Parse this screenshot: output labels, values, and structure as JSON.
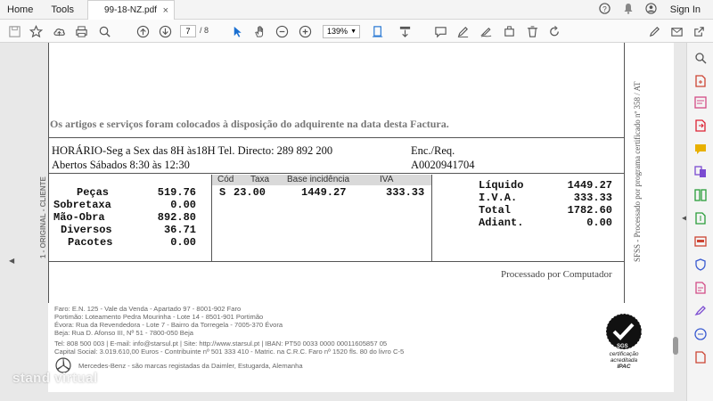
{
  "menu": {
    "home": "Home",
    "tools": "Tools",
    "tab_title": "99-18-NZ.pdf",
    "tab_close": "×",
    "sign_in": "Sign In"
  },
  "toolbar": {
    "page_current": "7",
    "page_total": "/ 8",
    "zoom": "139%"
  },
  "document": {
    "notice": "Os artigos e serviços foram colocados à disposição do adquirente na data desta Factura.",
    "schedule_line1": "HORÁRIO-Seg a Sex das 8H às18H Tel. Directo: 289 892 200",
    "schedule_line2": "Abertos Sábados 8:30 às 12:30",
    "enc_label": "Enc./Req.",
    "enc_value": "A0020941704",
    "side_left": "1 - ORIGINAL - CLIENTE",
    "side_right": "SFSS - Processado por programa certificado nº 358 / AT",
    "totals_left": [
      {
        "label": "Peças",
        "value": "519.76"
      },
      {
        "label": "Sobretaxa",
        "value": "0.00"
      },
      {
        "label": "Mão-Obra",
        "value": "892.80"
      },
      {
        "label": "Diversos",
        "value": "36.71"
      },
      {
        "label": "Pacotes",
        "value": "0.00"
      }
    ],
    "tax_headers": {
      "cod": "Cód",
      "taxa": "Taxa",
      "base": "Base incidência",
      "iva": "IVA"
    },
    "tax_row": {
      "cod": "S",
      "taxa": "23.00",
      "base": "1449.27",
      "iva": "333.33"
    },
    "totals_right": [
      {
        "label": "Líquido",
        "value": "1449.27"
      },
      {
        "label": "I.V.A.",
        "value": "333.33"
      },
      {
        "label": "Total",
        "value": "1782.60"
      },
      {
        "label": "Adiant.",
        "value": "0.00"
      }
    ],
    "processed": "Processado por Computador",
    "footer": [
      "Faro: E.N. 125 - Vale da Venda - Apartado 97 - 8001-902 Faro",
      "Portimão: Loteamento Pedra Mourinha - Lote 14 - 8501-901 Portimão",
      "Évora: Rua da Revendedora - Lote 7 - Bairro da Torregela - 7005-370 Évora",
      "Beja: Rua D. Afonso III, Nº 51 - 7800-050 Beja",
      "Tel: 808 500 003 | E-mail: info@starsul.pt | Site: http://www.starsul.pt | IBAN: PT50 0033 0000 00011605857 05",
      "Capital Social: 3.019.610,00 Euros - Contribuinte nº 501 333 410 - Matric. na C.R.C. Faro nº 1520 fls. 80 do livro C-5"
    ],
    "mercedes_note": "Mercedes-Benz - são marcas registadas da Daimler, Estugarda, Alemanha",
    "cert_line1": "SGS",
    "cert_line2": "certificação",
    "cert_line3": "acreditada",
    "cert_line4": "IPAC"
  },
  "watermark": "stand virtual"
}
